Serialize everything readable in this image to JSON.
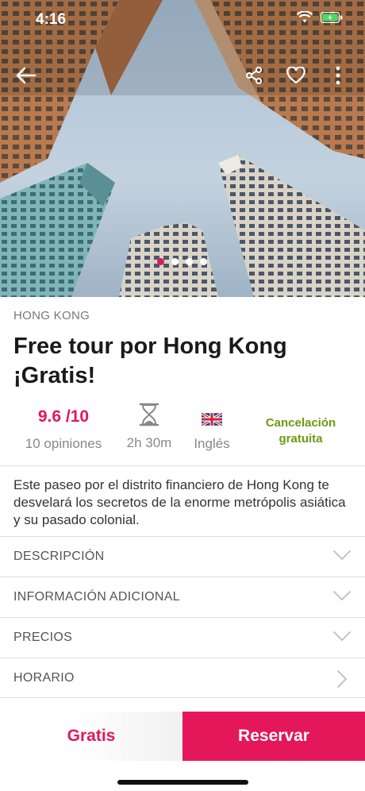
{
  "status": {
    "time": "4:16"
  },
  "hero": {
    "slide_count": 4,
    "active_slide": 1
  },
  "tour": {
    "city": "HONG KONG",
    "title": "Free tour por Hong Kong ¡Gratis!",
    "rating": "9.6 /10",
    "reviews": "10 opiniones",
    "duration": "2h 30m",
    "language": "Inglés",
    "cancellation": "Cancelación gratuita",
    "description": "Este paseo por el distrito financiero de Hong Kong te desvelará los secretos de la enorme metrópolis asiática y su pasado colonial."
  },
  "sections": [
    {
      "label": "DESCRIPCIÓN",
      "icon": "chevron-down-icon"
    },
    {
      "label": "INFORMACIÓN ADICIONAL",
      "icon": "chevron-down-icon"
    },
    {
      "label": "PRECIOS",
      "icon": "chevron-down-icon"
    },
    {
      "label": "HORARIO",
      "icon": "chevron-right-icon"
    }
  ],
  "footer": {
    "price_label": "Gratis",
    "book_label": "Reservar"
  },
  "colors": {
    "accent": "#e3175a",
    "green": "#6d9a12"
  }
}
